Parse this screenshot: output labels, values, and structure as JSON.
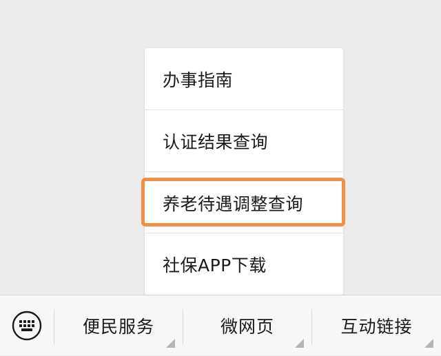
{
  "popup_menu": {
    "items": [
      {
        "label": "办事指南"
      },
      {
        "label": "认证结果查询"
      },
      {
        "label": "养老待遇调整查询"
      },
      {
        "label": "社保APP下载"
      }
    ],
    "highlighted_item": "养老待遇调整查询",
    "highlight_color": "#f0914a"
  },
  "bottom_bar": {
    "keyboard_icon": "keyboard-icon",
    "tabs": [
      {
        "label": "便民服务"
      },
      {
        "label": "微网页"
      },
      {
        "label": "互动链接"
      }
    ]
  },
  "colors": {
    "background": "#ececec",
    "menu_bg": "#ffffff",
    "bar_bg": "#f7f7f7",
    "text": "#1a1a1a"
  }
}
